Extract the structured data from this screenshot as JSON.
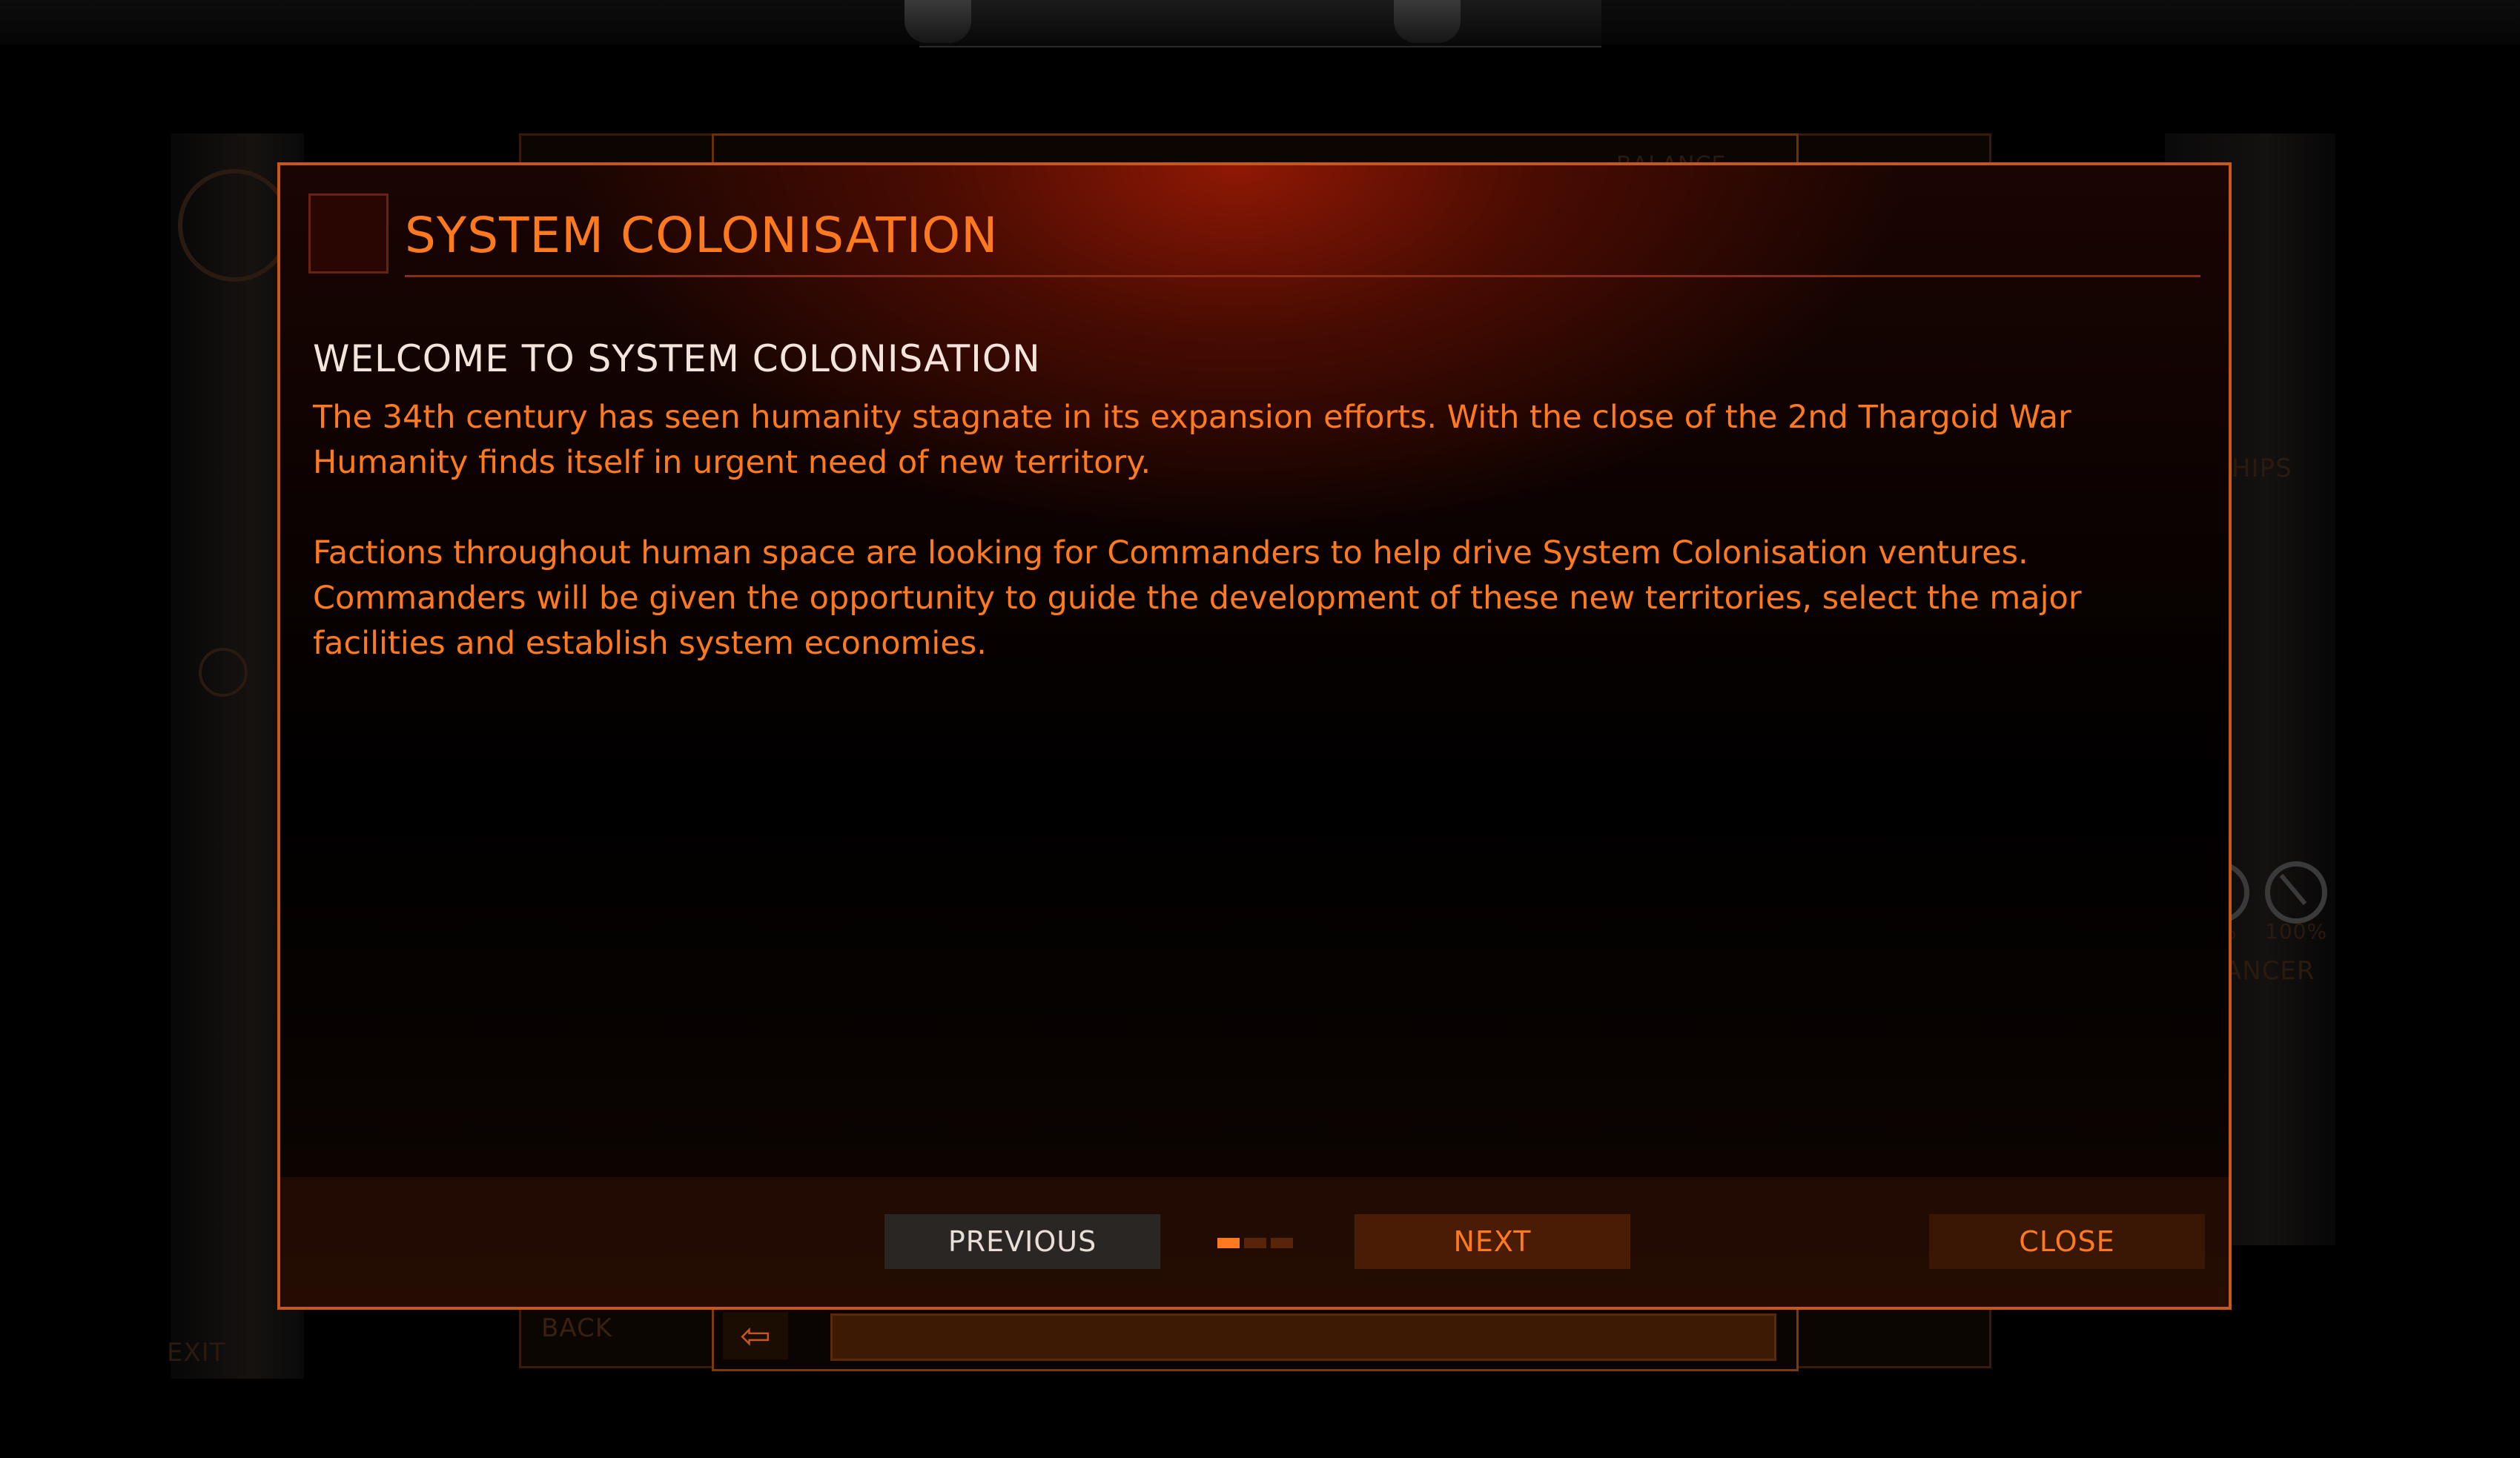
{
  "background": {
    "back_label": "BACK",
    "exit_label": "EXIT",
    "balance_label": "BALANCE",
    "ships_label": "HIPS",
    "gauge_value_1": "%",
    "gauge_value_2": "100%",
    "gauge_label": "ANCER",
    "back_icon": "exit-arrow-icon"
  },
  "dialog": {
    "title": "SYSTEM COLONISATION",
    "heading": "WELCOME TO SYSTEM COLONISATION",
    "paragraphs": [
      "The 34th century has seen humanity stagnate in its expansion efforts. With the close of the 2nd Thargoid War Humanity finds itself in urgent need of new territory.",
      "Factions throughout human space are looking for Commanders to help drive System Colonisation ventures. Commanders will be given the opportunity to guide the development of these new territories, select the major facilities and establish system economies."
    ],
    "buttons": {
      "previous": "PREVIOUS",
      "next": "NEXT",
      "close": "CLOSE"
    },
    "pager": {
      "current_page": 1,
      "total_pages": 3
    }
  },
  "colors": {
    "accent": "#ff7a1e",
    "heading": "#f3e4dc",
    "border": "#c8571a"
  }
}
